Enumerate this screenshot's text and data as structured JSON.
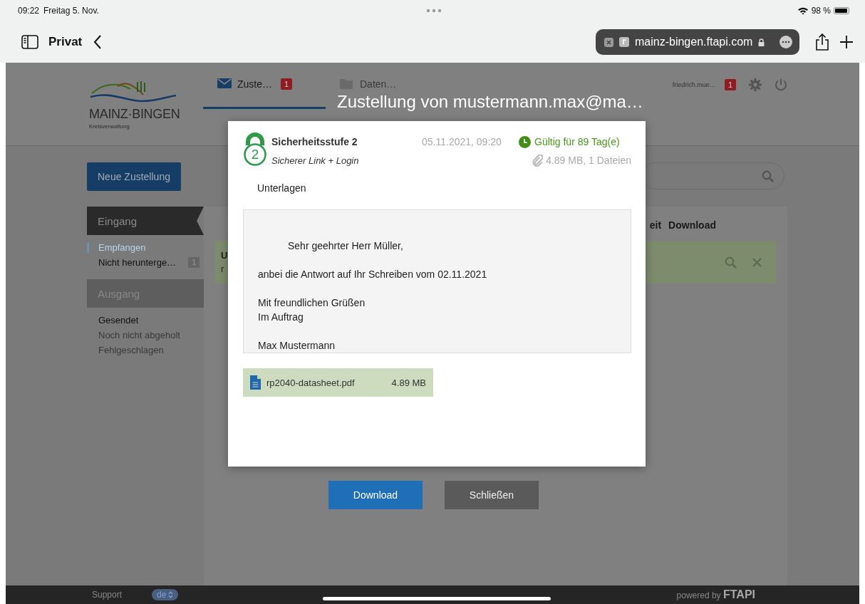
{
  "status_bar": {
    "time": "09:22",
    "date": "Freitag 5. Nov.",
    "battery": "98 %"
  },
  "browser": {
    "tab_group": "Privat",
    "url": "mainz-bingen.ftapi.com"
  },
  "header": {
    "logo_name": "MAINZ·BINGEN",
    "logo_sub": "Kreisverwaltung",
    "tabs": [
      {
        "label": "Zuste…",
        "badge": "1",
        "selected": true
      },
      {
        "label": "Daten…",
        "selected": false
      }
    ],
    "user": "friedrich.mue…",
    "user_badge": "1"
  },
  "new_button": "Neue Zustellung",
  "sidebar": [
    {
      "title": "Eingang",
      "selected": true,
      "items": [
        {
          "label": "Empfangen",
          "selected": true,
          "disabled": false
        },
        {
          "label": "Nicht herunterge…",
          "badge": "1",
          "selected": false,
          "disabled": false
        }
      ]
    },
    {
      "title": "Ausgang",
      "selected": false,
      "items": [
        {
          "label": "Gesendet",
          "selected": false,
          "disabled": false
        },
        {
          "label": "Noch nicht abgeholt",
          "selected": false,
          "disabled": true
        },
        {
          "label": "Fehlgeschlagen",
          "selected": false,
          "disabled": true
        }
      ]
    }
  ],
  "table": {
    "columns": [
      "eit",
      "Download"
    ],
    "rows": [
      {
        "cells": [
          "U",
          "r"
        ]
      }
    ]
  },
  "dialog": {
    "title": "Zustellung von mustermann.max@ma…",
    "security_level": "2",
    "security_title": "Sicherheitsstufe 2",
    "security_sub": "Sicherer Link + Login",
    "date": "05.11.2021, 09:20",
    "validity": "Gültig für 89 Tag(e)",
    "size": "4.89 MB, 1 Dateien",
    "subject": "Unterlagen",
    "message": [
      "Sehr geehrter Herr Müller,",
      "anbei die Antwort auf Ihr Schreiben vom 02.11.2021",
      "Mit freundlichen Grüßen\nIm Auftrag",
      "Max Mustermann"
    ],
    "files": [
      {
        "name": "rp2040-datasheet.pdf",
        "size": "4.89 MB"
      }
    ],
    "buttons": [
      {
        "label": "Download",
        "kind": "primary"
      },
      {
        "label": "Schließen",
        "kind": "secondary"
      }
    ]
  },
  "footer": {
    "support": "Support",
    "language": "de",
    "powered_by": "powered by",
    "brand": "FTAPI"
  }
}
